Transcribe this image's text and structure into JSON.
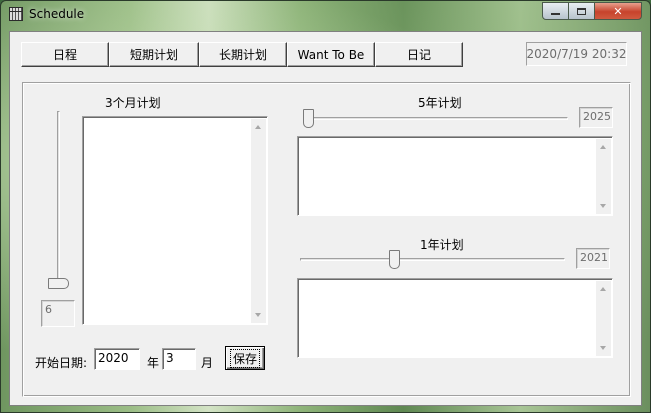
{
  "window": {
    "title": "Schedule",
    "close_glyph": "✕"
  },
  "tabs": [
    "日程",
    "短期计划",
    "长期计划",
    "Want To Be",
    "日记"
  ],
  "datetime": "2020/7/19 20:32",
  "plan3m": {
    "label": "3个月计划",
    "slider_value": "6",
    "slider_level": 0
  },
  "plan5y": {
    "label": "5年计划",
    "slider_value": "2025",
    "slider_level": 0
  },
  "plan1y": {
    "label": "1年计划",
    "slider_value": "2021",
    "slider_level": 0.35
  },
  "start": {
    "label": "开始日期:",
    "year": "2020",
    "year_unit": "年",
    "month": "3",
    "month_unit": "月"
  },
  "save_label": "保存"
}
